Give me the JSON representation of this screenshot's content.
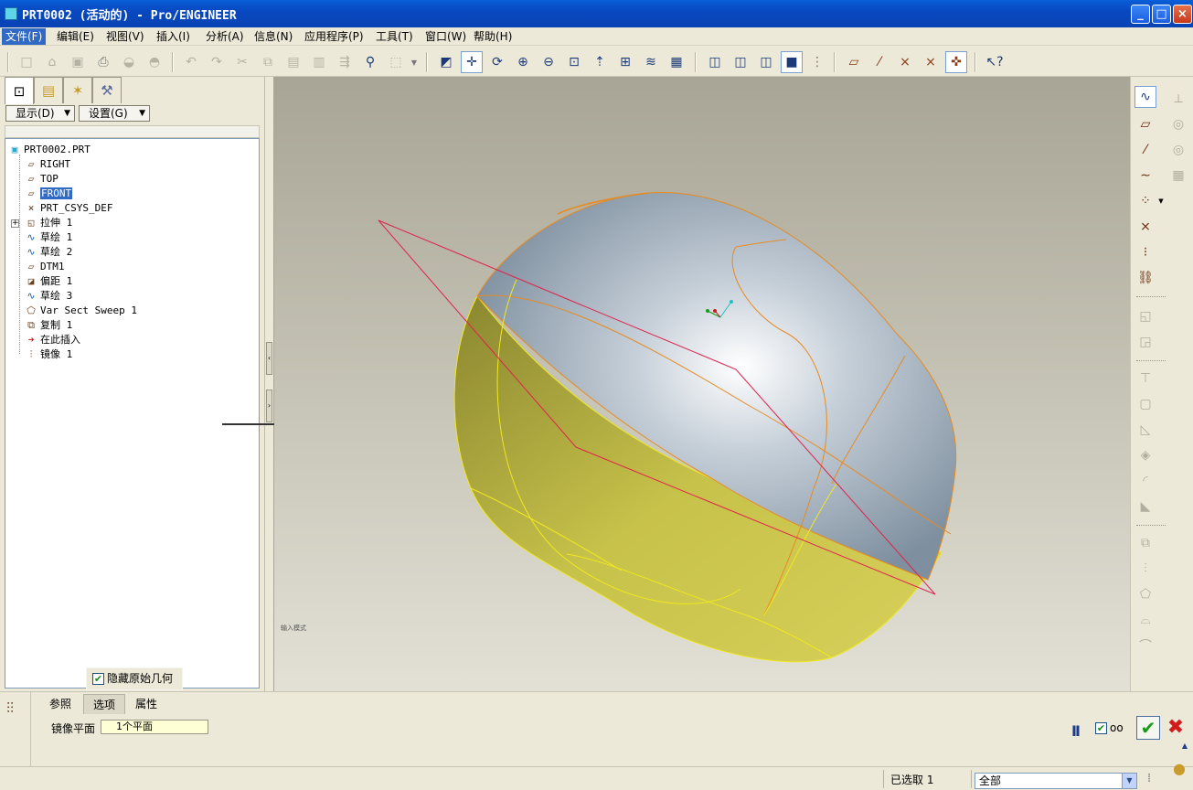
{
  "window": {
    "title": "PRT0002 (活动的) - Pro/ENGINEER",
    "buttons": [
      "_",
      "□",
      "×"
    ]
  },
  "menubar": [
    "文件(F)",
    "编辑(E)",
    "视图(V)",
    "插入(I)",
    "分析(A)",
    "信息(N)",
    "应用程序(P)",
    "工具(T)",
    "窗口(W)",
    "帮助(H)"
  ],
  "toolbar": {
    "icons": [
      "new-icon",
      "open-icon",
      "save-icon",
      "print-icon",
      "send-icon",
      "send-2-icon",
      "undo-icon",
      "redo-icon",
      "cut-icon",
      "copy-icon",
      "paste-icon",
      "paste-special-icon",
      "regenerate-icon",
      "find-icon",
      "select-box-icon",
      "dropdown-icon",
      "repaint-icon",
      "spin-center-icon",
      "orient-icon",
      "zoom-in-icon",
      "zoom-out-icon",
      "refit-icon",
      "reorient-icon",
      "saved-views-icon",
      "layers-icon",
      "view-manager-icon",
      "wireframe-icon",
      "hidden-line-icon",
      "no-hidden-icon",
      "shading-icon",
      "model-tree-toggle-icon",
      "datum-planes-icon",
      "datum-axes-icon",
      "datum-points-icon",
      "coordinate-systems-icon",
      "spin-center-toggle-icon",
      "whats-this-icon"
    ]
  },
  "left_panel": {
    "show_btn": "显示(D)",
    "settings_btn": "设置(G)",
    "tree": [
      {
        "label": "PRT0002.PRT",
        "icon": "part-icon",
        "level": 0
      },
      {
        "label": "RIGHT",
        "icon": "datum-plane-icon",
        "level": 1
      },
      {
        "label": "TOP",
        "icon": "datum-plane-icon",
        "level": 1
      },
      {
        "label": "FRONT",
        "icon": "datum-plane-icon",
        "level": 1,
        "selected": true
      },
      {
        "label": "PRT_CSYS_DEF",
        "icon": "csys-icon",
        "level": 1
      },
      {
        "label": "拉伸 1",
        "icon": "extrude-icon",
        "level": 1,
        "expandable": true
      },
      {
        "label": "草绘 1",
        "icon": "sketch-icon",
        "level": 1
      },
      {
        "label": "草绘 2",
        "icon": "sketch-icon",
        "level": 1
      },
      {
        "label": "DTM1",
        "icon": "datum-plane-icon",
        "level": 1
      },
      {
        "label": "偏距 1",
        "icon": "offset-icon",
        "level": 1
      },
      {
        "label": "草绘 3",
        "icon": "sketch-icon",
        "level": 1
      },
      {
        "label": "Var Sect Sweep 1",
        "icon": "sweep-icon",
        "level": 1
      },
      {
        "label": "复制 1",
        "icon": "copy-feature-icon",
        "level": 1
      },
      {
        "label": "在此插入",
        "icon": "insert-here-icon",
        "level": 1
      },
      {
        "label": "镜像 1",
        "icon": "mirror-icon",
        "level": 1
      }
    ]
  },
  "viewport": {
    "hint": "输入模式"
  },
  "dashboard": {
    "tabs": [
      "参照",
      "选项",
      "属性"
    ],
    "active_tab": "选项",
    "popup_checkbox": "隐藏原始几何",
    "mirror_plane_label": "镜像平面",
    "mirror_plane_value": "1个平面",
    "pause": "II",
    "ok": "✔",
    "cancel": "✖"
  },
  "statusbar": {
    "selected": "已选取 1",
    "filter": "全部"
  },
  "colors": {
    "titlebar": "#0a5fd8",
    "surface_gray": "#a9b6c4",
    "surface_yellow": "#c8c04a",
    "edge_orange": "#e78a20",
    "datum_red": "#e0204a"
  }
}
